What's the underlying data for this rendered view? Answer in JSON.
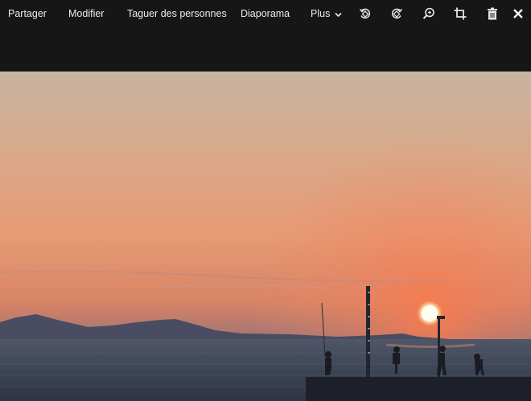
{
  "toolbar": {
    "share_label": "Partager",
    "edit_label": "Modifier",
    "tag_people_label": "Taguer des personnes",
    "slideshow_label": "Diaporama",
    "more_label": "Plus",
    "icons": [
      "rotate-left-icon",
      "rotate-right-icon",
      "zoom-icon",
      "crop-icon",
      "trash-icon",
      "close-icon"
    ]
  },
  "photo": {
    "subject": "sunset over the sea with fishermen on a pier"
  },
  "colors": {
    "background": "#161616",
    "toolbar_text": "#ececec"
  }
}
